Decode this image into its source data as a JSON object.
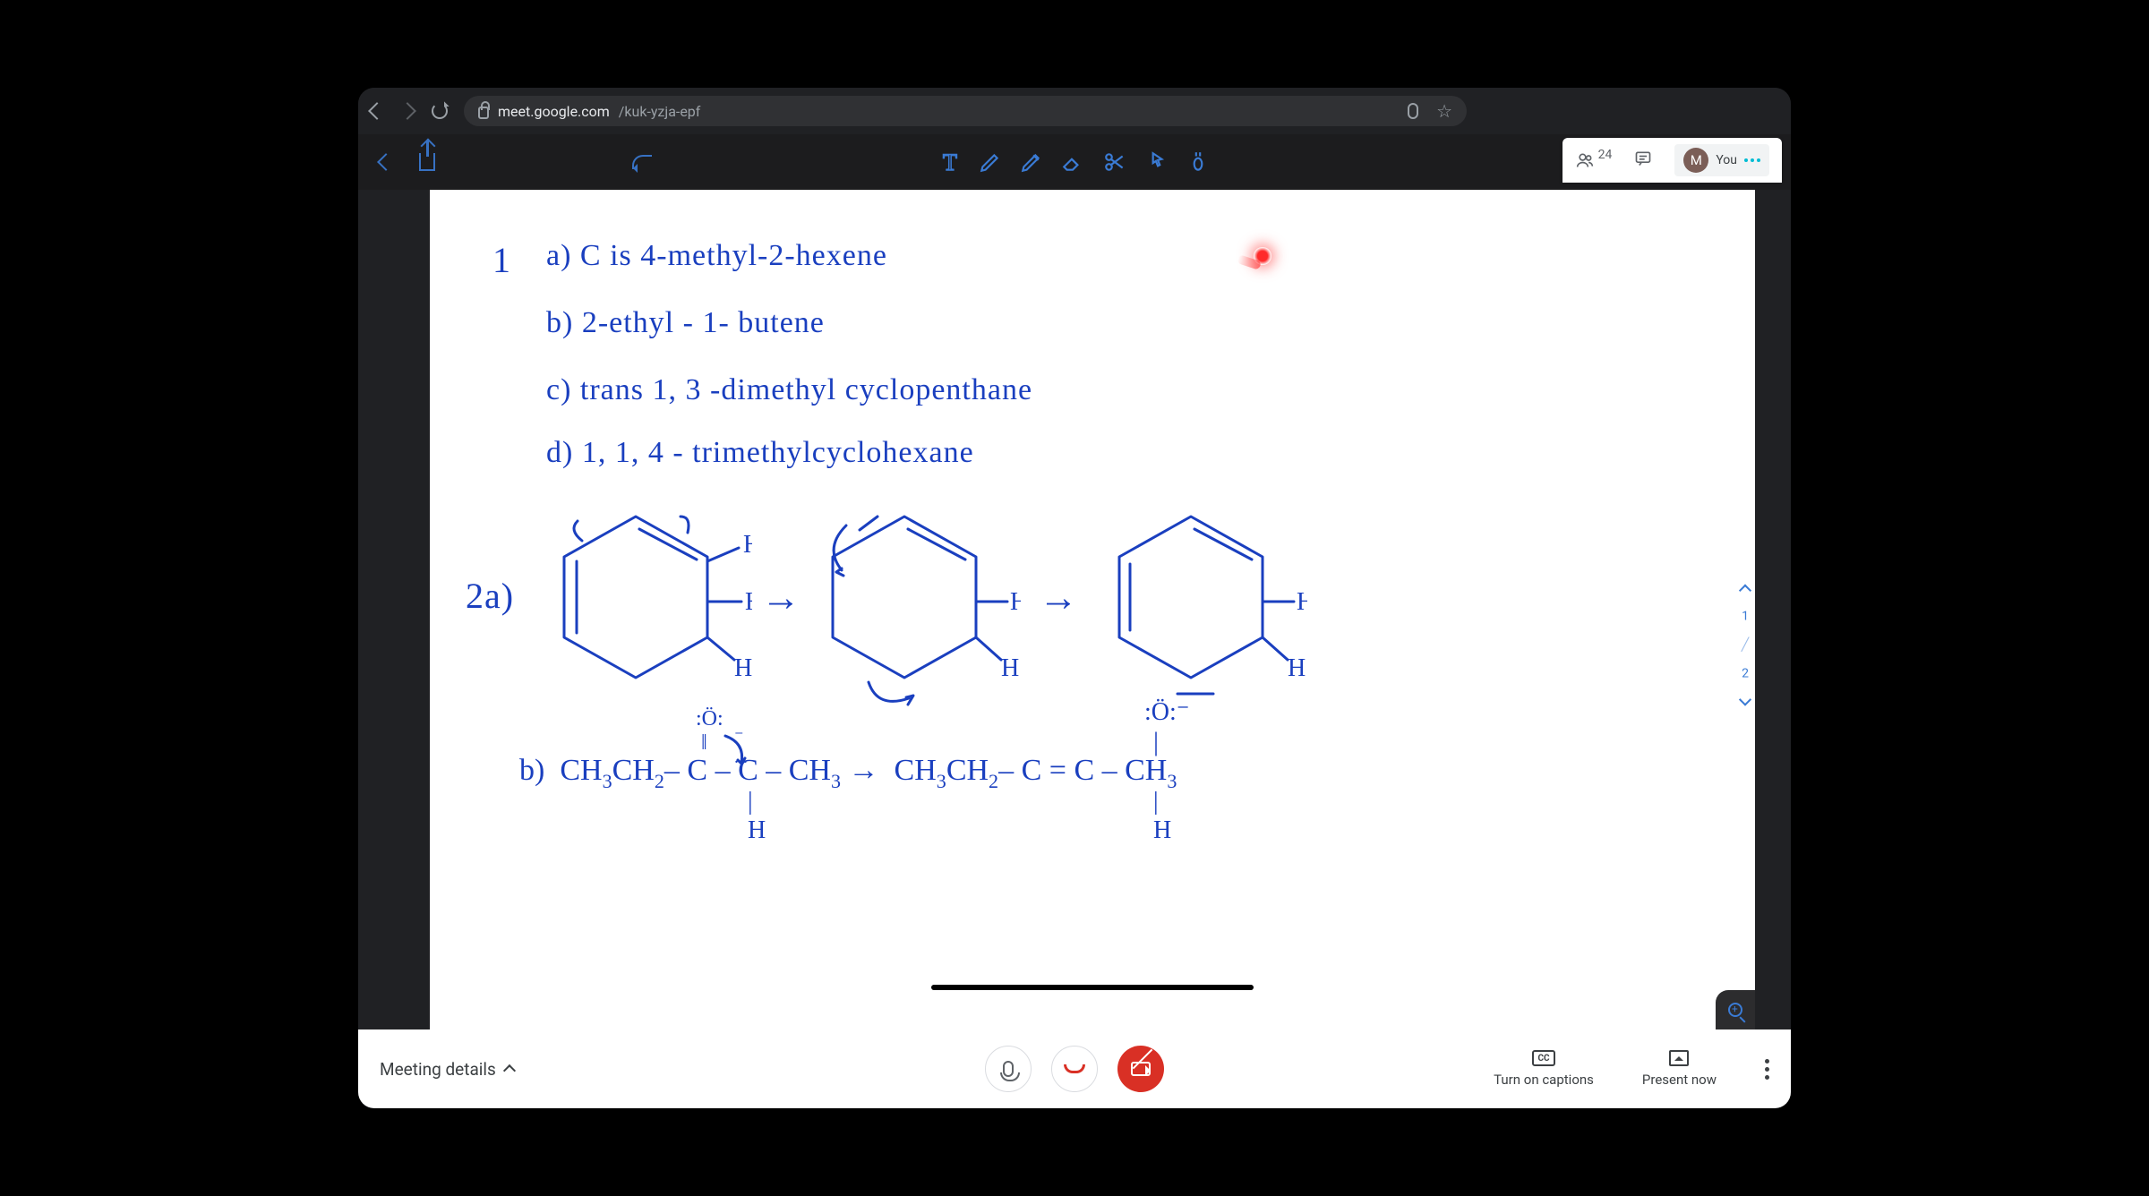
{
  "browser": {
    "domain": "meet.google.com",
    "path": "/kuk-yzja-epf"
  },
  "meet": {
    "participant_count": "24",
    "you_label": "You",
    "avatar_initial": "M"
  },
  "whiteboard": {
    "q1_num": "1",
    "line_a": "a)  C  is  4-methyl-2-hexene",
    "line_b": "b) 2-ethyl - 1- butene",
    "line_c": "c) trans 1, 3 -dimethyl cyclopenthane",
    "line_d": "d)  1, 1, 4 - trimethylcyclohexane",
    "q2a_label": "2a)",
    "h_label": "H",
    "arrow": "→",
    "q2b_prefix": "b)  CH",
    "page_current": "1",
    "page_total": "2",
    "formula_2b_left": "CH₃CH₂– C – C – CH₃",
    "formula_2b_right": "CH₃CH₂– C = C – CH₃",
    "o_label": "O",
    "o_charge": ":Ö:⁻"
  },
  "bottom": {
    "meeting_details": "Meeting details",
    "captions": "Turn on captions",
    "present": "Present now",
    "cc": "CC"
  }
}
